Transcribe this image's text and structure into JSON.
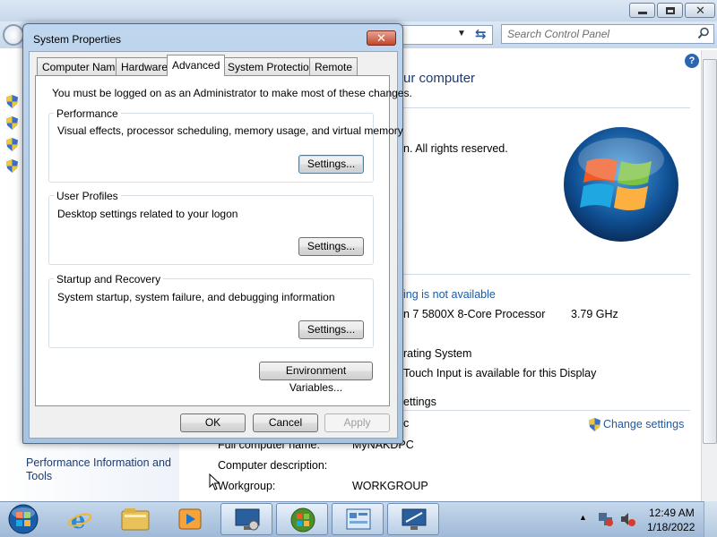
{
  "control_panel": {
    "search_placeholder": "Search Control Panel",
    "heading_partial": "ur computer",
    "copyright_partial": "n.  All rights reserved.",
    "rating_partial": "ing is not available",
    "processor_partial": "n 7 5800X 8-Core Processor",
    "processor_speed": "3.79 GHz",
    "system_type_partial": "rating System",
    "touch_partial": "Touch Input is available for this Display",
    "settings_heading_partial": "ettings",
    "change_settings": "Change settings",
    "computer_name_partial": "c",
    "full_computer_name_label": "Full computer name:",
    "full_computer_name_value": "MyNAKDPC",
    "computer_description_label": "Computer description:",
    "workgroup_label": "Workgroup:",
    "workgroup_value": "WORKGROUP",
    "left_pane_link": "Performance Information and Tools",
    "left_pane_link_line1": "Performance Information and",
    "left_pane_link_line2": "Tools"
  },
  "dialog": {
    "title": "System Properties",
    "tabs": [
      "Computer Name",
      "Hardware",
      "Advanced",
      "System Protection",
      "Remote"
    ],
    "active_tab": "Advanced",
    "admin_notice": "You must be logged on as an Administrator to make most of these changes.",
    "performance": {
      "label": "Performance",
      "description": "Visual effects, processor scheduling, memory usage, and virtual memory",
      "button": "Settings..."
    },
    "user_profiles": {
      "label": "User Profiles",
      "description": "Desktop settings related to your logon",
      "button": "Settings..."
    },
    "startup_recovery": {
      "label": "Startup and Recovery",
      "description": "System startup, system failure, and debugging information",
      "button": "Settings..."
    },
    "env_button": "Environment Variables...",
    "ok": "OK",
    "cancel": "Cancel",
    "apply": "Apply"
  },
  "taskbar": {
    "time": "12:49 AM",
    "date": "1/18/2022"
  },
  "colors": {
    "link": "#1a5aa8",
    "dialog_frame": "#a7c3e2",
    "taskbar": "#b4cbe3"
  }
}
